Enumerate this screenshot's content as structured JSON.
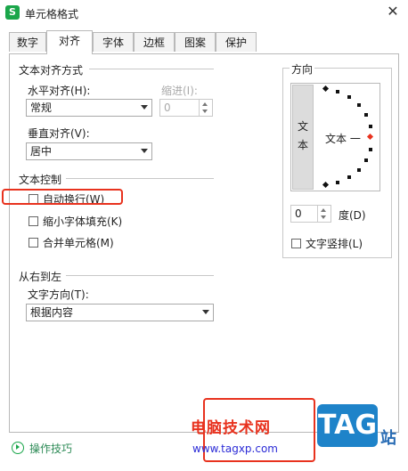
{
  "window": {
    "title": "单元格格式",
    "app_icon_letter": "S",
    "close_glyph": "✕"
  },
  "tabs": [
    {
      "label": "数字"
    },
    {
      "label": "对齐"
    },
    {
      "label": "字体"
    },
    {
      "label": "边框"
    },
    {
      "label": "图案"
    },
    {
      "label": "保护"
    }
  ],
  "active_tab": "对齐",
  "text_alignment": {
    "section_title": "文本对齐方式",
    "horizontal_label": "水平对齐(H):",
    "horizontal_value": "常规",
    "indent_label": "缩进(I):",
    "indent_value": "0",
    "vertical_label": "垂直对齐(V):",
    "vertical_value": "居中"
  },
  "text_control": {
    "section_title": "文本控制",
    "wrap_text": {
      "label": "自动换行(W)",
      "checked": false
    },
    "shrink_to_fit": {
      "label": "缩小字体填充(K)",
      "checked": false
    },
    "merge_cells": {
      "label": "合并单元格(M)",
      "checked": false
    }
  },
  "rtl": {
    "section_title": "从右到左",
    "direction_label": "文字方向(T):",
    "direction_value": "根据内容"
  },
  "orientation": {
    "section_title": "方向",
    "vertical_text": [
      "文",
      "本"
    ],
    "sample_text": "文本 一",
    "degree_value": "0",
    "degree_label": "度(D)",
    "vertical_stack": {
      "label": "文字竖排(L)",
      "checked": false
    }
  },
  "footer": {
    "tips_label": "操作技巧"
  },
  "watermark": {
    "site_name": "电脑技术网",
    "url": "www.tagxp.com",
    "logo_text": "TAG",
    "trailing_text": "站"
  },
  "colors": {
    "accent_green": "#1aa64a",
    "highlight_red": "#e8321e",
    "logo_blue": "#1e83c9"
  }
}
